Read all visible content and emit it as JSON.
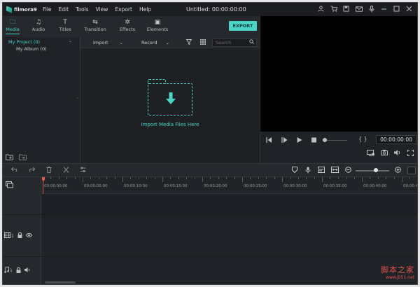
{
  "app": {
    "logo_text": "filmora9",
    "title": "Untitled: 00:00:00:00",
    "menu": [
      "File",
      "Edit",
      "Tools",
      "View",
      "Export",
      "Help"
    ]
  },
  "tabs": [
    {
      "label": "Media",
      "icon": "folder-icon",
      "glyph": "🗀"
    },
    {
      "label": "Audio",
      "icon": "music-note-icon",
      "glyph": "♫"
    },
    {
      "label": "Titles",
      "icon": "text-icon",
      "glyph": "T"
    },
    {
      "label": "Transition",
      "icon": "transition-icon",
      "glyph": "⇆"
    },
    {
      "label": "Effects",
      "icon": "effects-icon",
      "glyph": "✲"
    },
    {
      "label": "Elements",
      "icon": "image-icon",
      "glyph": "▣"
    }
  ],
  "export_label": "EXPORT",
  "left_panel": {
    "project": "My Project (0)",
    "album": "My Album (0)"
  },
  "media_bar": {
    "import_label": "Import",
    "record_label": "Record",
    "search_placeholder": "Search"
  },
  "import": {
    "label": "Import Media Files Here"
  },
  "preview": {
    "timecode": "00:00:00:00",
    "braces": "{ }"
  },
  "ruler": {
    "labels": [
      "00:00:00:00",
      "00:00:05:00",
      "00:00:10:00",
      "00:00:15:00",
      "00:00:20:00",
      "00:00:25:00",
      "00:00:30:00",
      "00:00:35:00",
      "00:00:40:00",
      "00:00:4"
    ]
  },
  "tracks": {
    "video_num": "1",
    "audio_num": "1"
  },
  "watermark": {
    "main": "脚本之家",
    "url": "www.jb51.net"
  },
  "colors": {
    "accent": "#4ad3c6",
    "playhead": "#e25b4d",
    "watermark": "#e0534b"
  }
}
